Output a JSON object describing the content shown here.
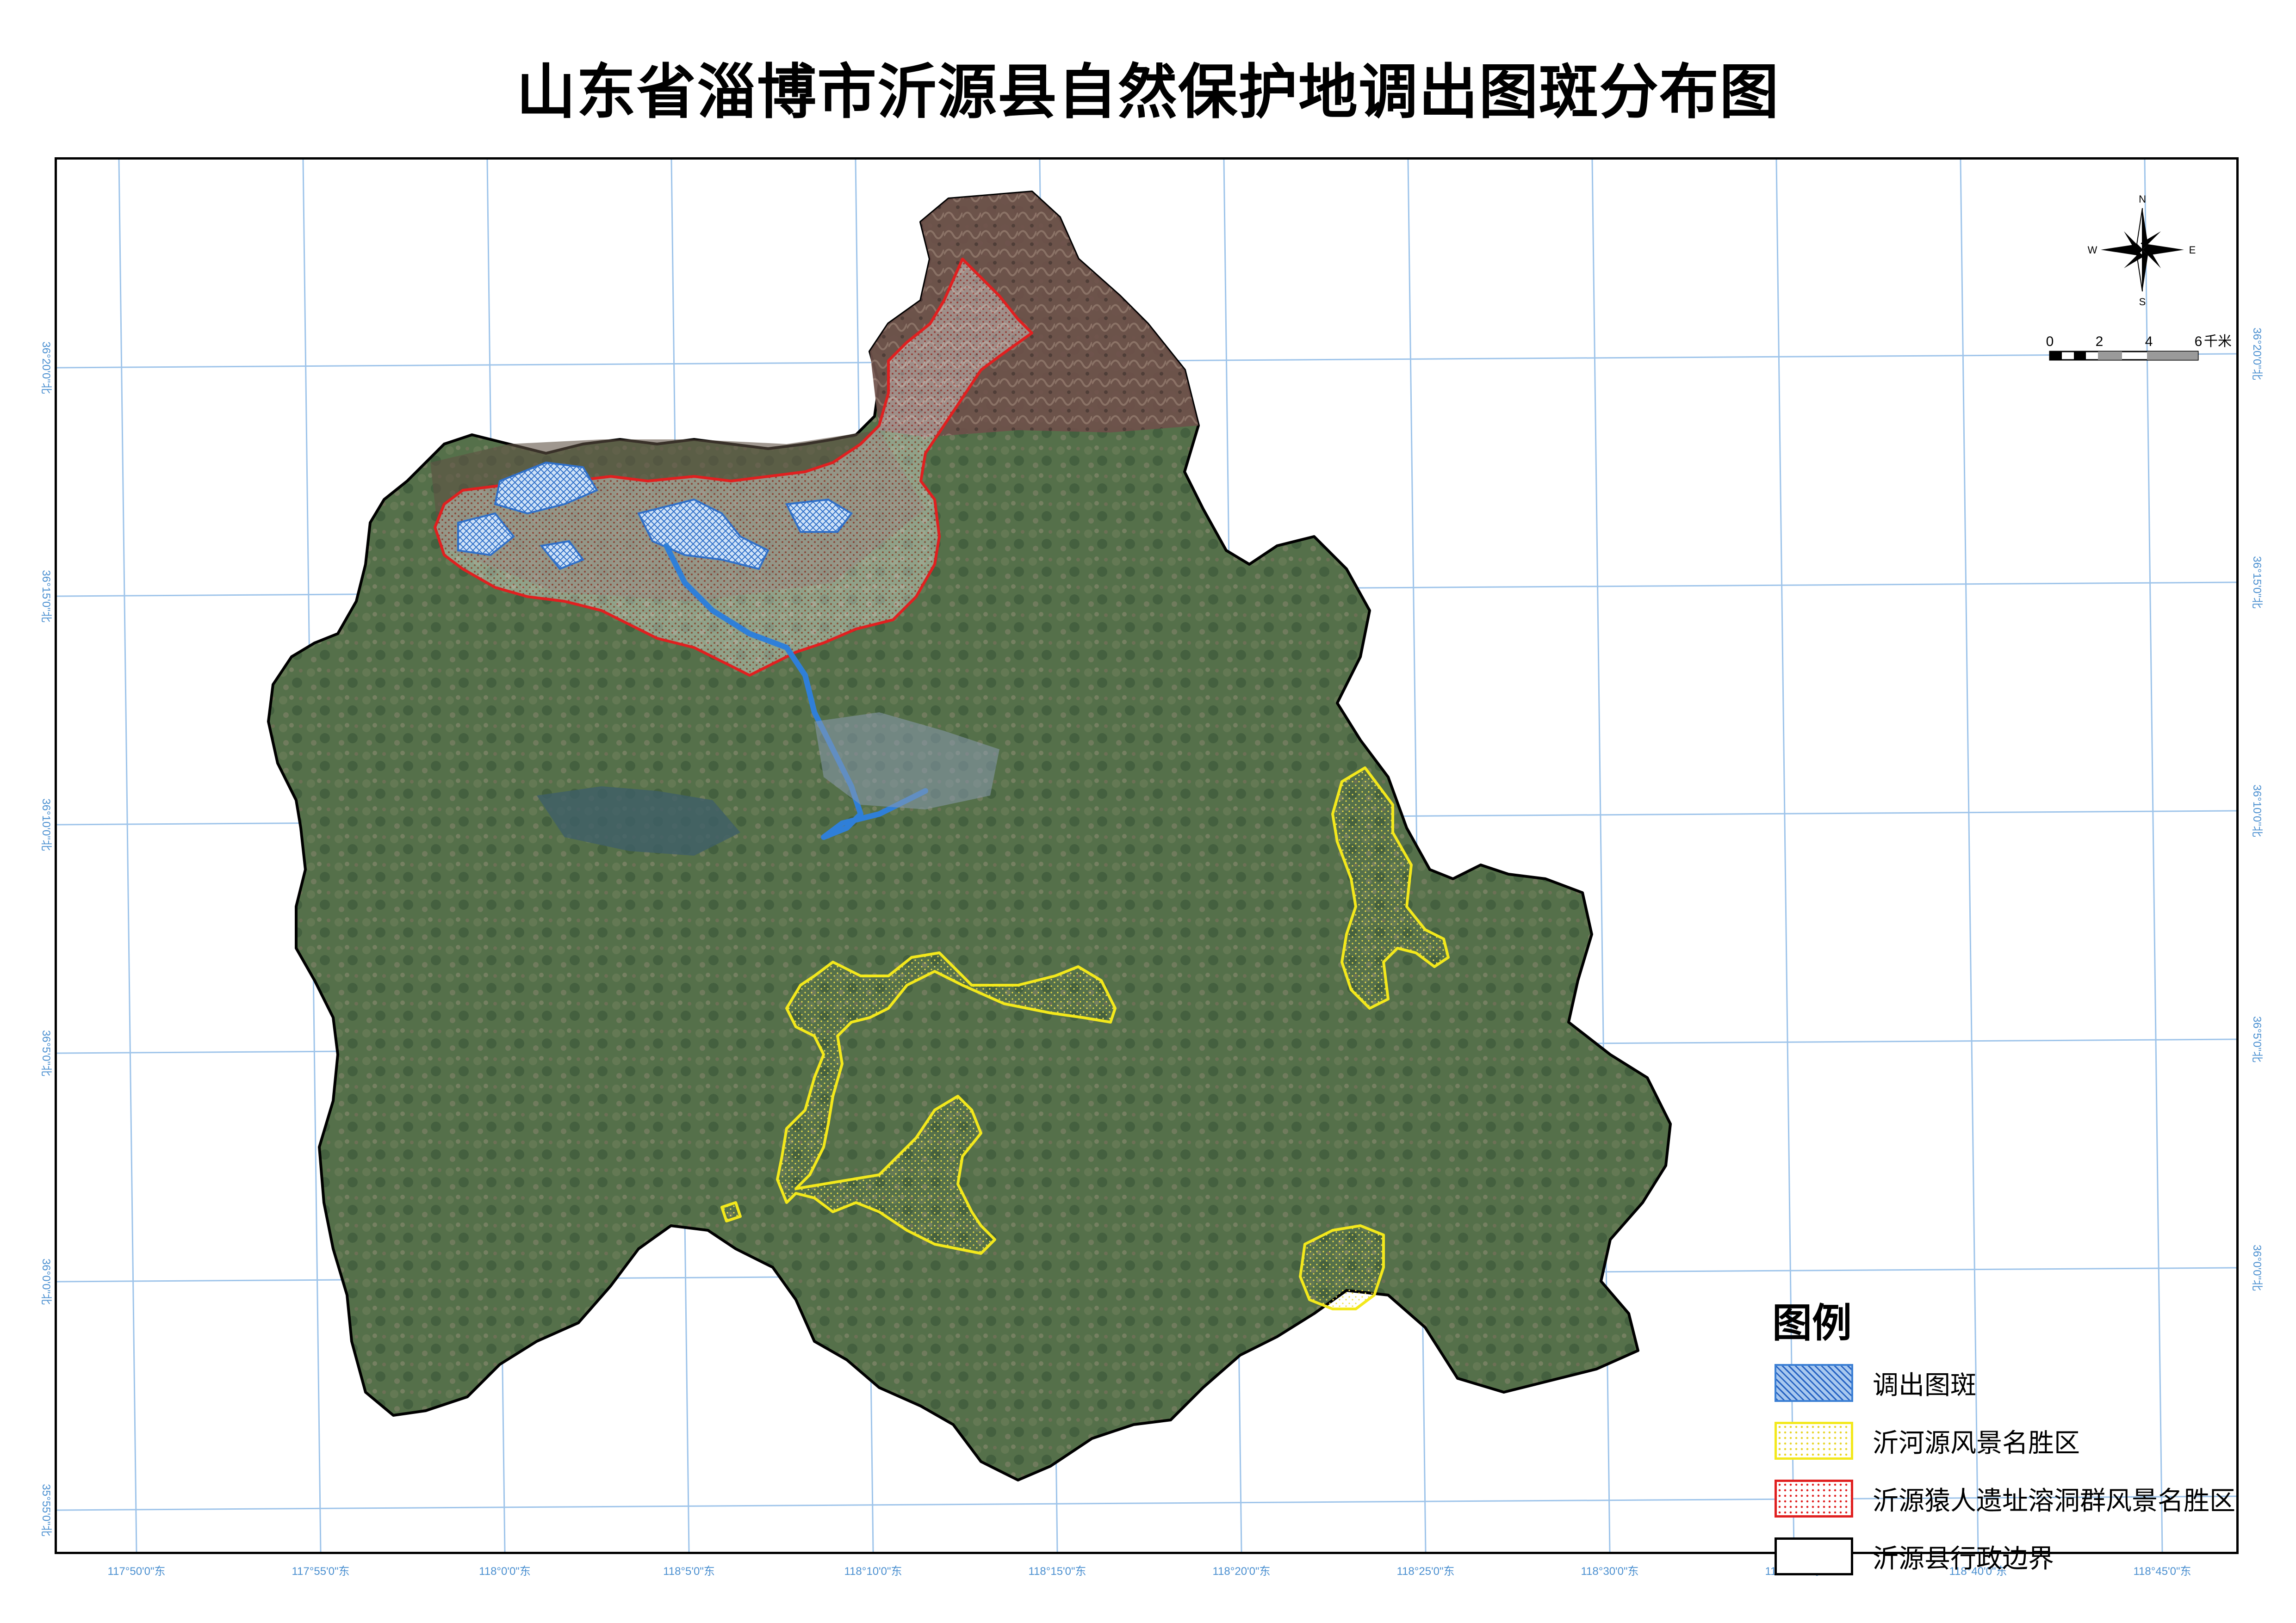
{
  "title": "山东省淄博市沂源县自然保护地调出图斑分布图",
  "compass": {
    "n": "N",
    "s": "S",
    "e": "E",
    "w": "W"
  },
  "scale_bar": {
    "labels": [
      "0",
      "2",
      "4",
      "6"
    ],
    "unit": "千米"
  },
  "graticule": {
    "bottom": [
      "117°50'0\"东",
      "117°55'0\"东",
      "118°0'0\"东",
      "118°5'0\"东",
      "118°10'0\"东",
      "118°15'0\"东",
      "118°20'0\"东",
      "118°25'0\"东",
      "118°30'0\"东",
      "118°35'0\"东",
      "118°40'0\"东",
      "118°45'0\"东"
    ],
    "left": [
      "36°20'0\"北",
      "36°15'0\"北",
      "36°10'0\"北",
      "36°5'0\"北",
      "36°0'0\"北",
      "35°55'0\"北"
    ],
    "right": [
      "36°20'0\"北",
      "36°15'0\"北",
      "36°10'0\"北",
      "36°5'0\"北",
      "36°0'0\"北"
    ]
  },
  "legend": {
    "title": "图例",
    "items": [
      {
        "label": "调出图斑",
        "color": "#3b7fd4",
        "pattern": "crosshatch"
      },
      {
        "label": "沂河源风景名胜区",
        "color": "#f3e81c",
        "pattern": "dots"
      },
      {
        "label": "沂源猿人遗址溶洞群风景名胜区",
        "color": "#e02020",
        "pattern": "dots"
      },
      {
        "label": "沂源县行政边界",
        "color": "#000000",
        "pattern": "outline"
      }
    ]
  },
  "colors": {
    "county_fill": "#4f6a44",
    "north_relief": "#6e4f4a",
    "river": "#2f7fd8",
    "graticule": "#9ec4ea"
  }
}
